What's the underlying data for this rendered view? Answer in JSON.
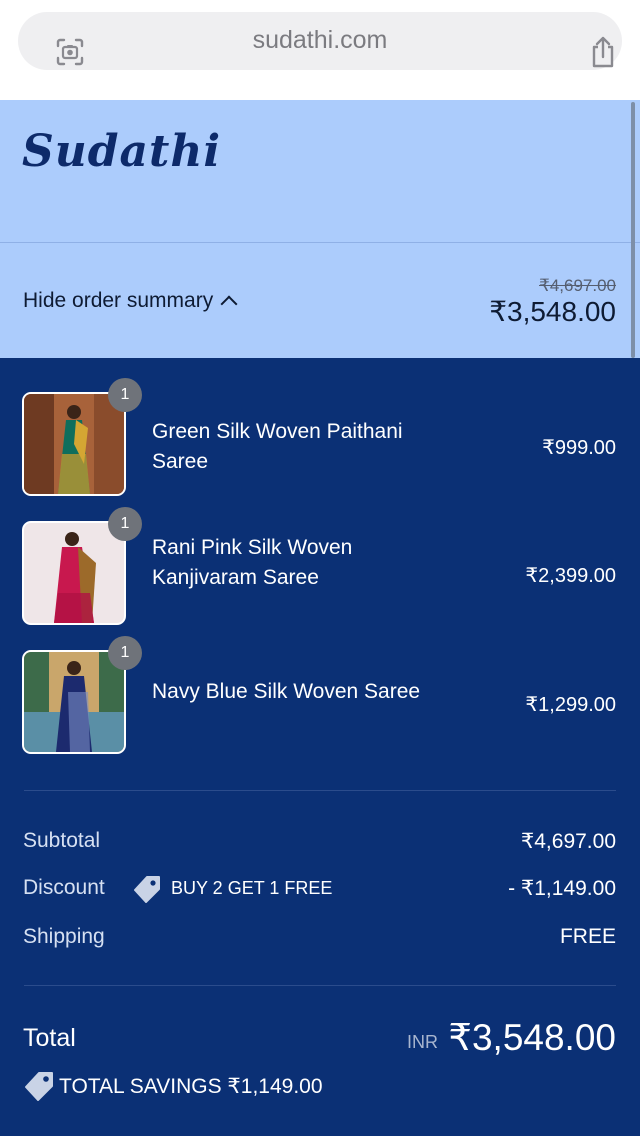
{
  "browser": {
    "url": "sudathi.com",
    "left_icon": "camera-search-icon",
    "right_icon": "share-icon"
  },
  "header": {
    "logo_text": "Sudathi"
  },
  "summary_bar": {
    "toggle_label": "Hide order summary",
    "original_price": "₹4,697.00",
    "price": "₹3,548.00"
  },
  "items": [
    {
      "name": "Green Silk Woven Paithani Saree",
      "price": "₹999.00",
      "quantity": "1"
    },
    {
      "name": "Rani Pink Silk Woven Kanjivaram Saree",
      "price": "₹2,399.00",
      "quantity": "1"
    },
    {
      "name": "Navy Blue Silk Woven Saree",
      "price": "₹1,299.00",
      "quantity": "1"
    }
  ],
  "totals": {
    "subtotal_label": "Subtotal",
    "subtotal_value": "₹4,697.00",
    "discount_label": "Discount",
    "discount_code": "BUY 2 GET 1 FREE",
    "discount_value": "- ₹1,149.00",
    "shipping_label": "Shipping",
    "shipping_value": "FREE",
    "total_label": "Total",
    "currency": "INR",
    "total_value": "₹3,548.00",
    "savings_text": "TOTAL SAVINGS ₹1,149.00"
  },
  "colors": {
    "header_bg": "#acccfc",
    "main_bg": "#0b3075",
    "badge_bg": "#6f737a"
  }
}
